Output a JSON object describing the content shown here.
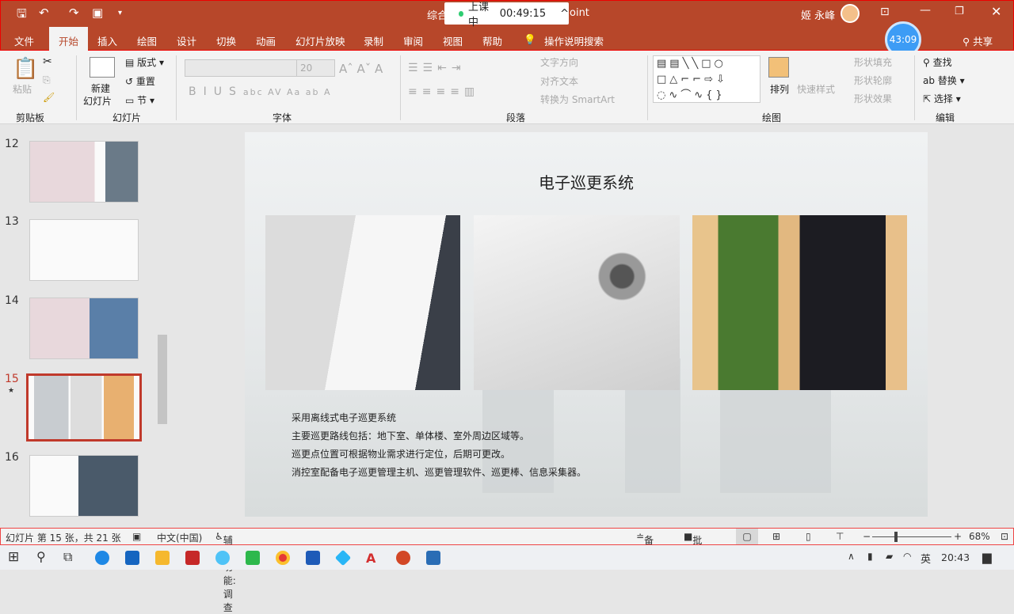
{
  "window": {
    "title": "综合...PowerPoint",
    "title_visible": "综合",
    "title_suffix": "oint",
    "user": "姬 永峰"
  },
  "class_banner": {
    "status": "上课中",
    "elapsed": "00:49:15"
  },
  "timer": "43:09",
  "tabs": [
    "文件",
    "开始",
    "插入",
    "绘图",
    "设计",
    "切换",
    "动画",
    "幻灯片放映",
    "录制",
    "审阅",
    "视图",
    "帮助"
  ],
  "active_tab": "开始",
  "tell_me": "操作说明搜索",
  "share": "共享",
  "ribbon": {
    "clipboard": {
      "paste": "粘贴",
      "label": "剪贴板"
    },
    "slides": {
      "new_slide": "新建",
      "new_slide2": "幻灯片",
      "layout": "版式",
      "reset": "重置",
      "section": "节",
      "label": "幻灯片"
    },
    "font": {
      "font_size": "20",
      "label": "字体"
    },
    "paragraph": {
      "text_direction": "文字方向",
      "align_text": "对齐文本",
      "smartart": "转换为 SmartArt",
      "label": "段落"
    },
    "drawing": {
      "arrange": "排列",
      "quick_styles": "快速样式",
      "fill": "形状填充",
      "outline": "形状轮廓",
      "effects": "形状效果",
      "label": "绘图"
    },
    "editing": {
      "find": "查找",
      "replace": "替换",
      "select": "选择",
      "label": "编辑"
    }
  },
  "thumbnails": [
    {
      "num": "12"
    },
    {
      "num": "13"
    },
    {
      "num": "14"
    },
    {
      "num": "15",
      "selected": true
    },
    {
      "num": "16"
    }
  ],
  "slide": {
    "title": "电子巡更系统",
    "bullets": [
      "采用离线式电子巡更系统",
      "主要巡更路线包括：地下室、单体楼、室外周边区域等。",
      "巡更点位置可根据物业需求进行定位，后期可更改。",
      "消控室配备电子巡更管理主机、巡更管理软件、巡更棒、信息采集器。"
    ]
  },
  "status": {
    "slide_info": "幻灯片 第 15 张，共 21 张",
    "language": "中文(中国)",
    "accessibility": "辅助功能: 调查",
    "notes": "备注",
    "comments": "批注",
    "zoom": "68%"
  },
  "taskbar": {
    "ime": "英",
    "time": "20:43"
  },
  "colors": {
    "accent": "#b7472a",
    "selection": "#c0392b",
    "timer": "#3d9cf5"
  }
}
